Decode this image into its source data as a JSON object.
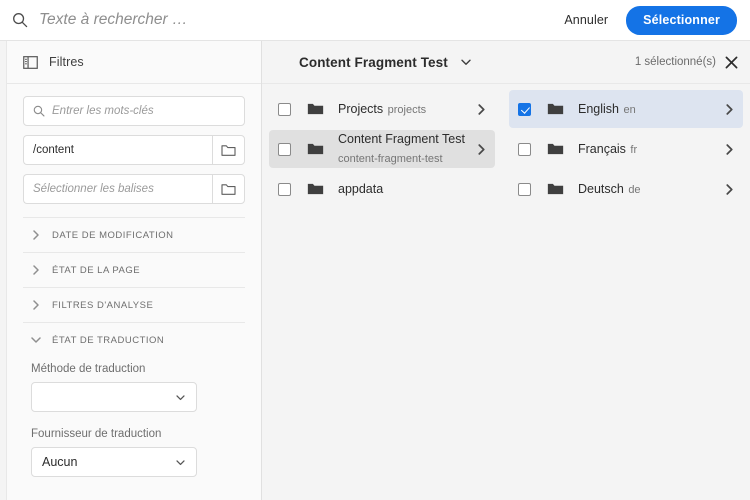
{
  "header": {
    "search_placeholder": "Texte à rechercher …",
    "search_value": "",
    "search_icon": "search-icon",
    "cancel_label": "Annuler",
    "select_label": "Sélectionner",
    "accent_color": "#1473e6"
  },
  "sidebar": {
    "panel_icon": "rail-left-icon",
    "title": "Filtres",
    "keyword_field": {
      "icon": "search-icon",
      "placeholder": "Entrer les mots-clés",
      "value": ""
    },
    "path_field": {
      "placeholder": "",
      "value": "/content",
      "picker_icon": "folder-open-icon"
    },
    "tags_field": {
      "placeholder": "Sélectionner les balises",
      "value": "",
      "picker_icon": "folder-open-icon"
    },
    "accordions": [
      {
        "label": "Date de modification",
        "expanded": false,
        "icon": "chevron-right-icon"
      },
      {
        "label": "État de la page",
        "expanded": false,
        "icon": "chevron-right-icon"
      },
      {
        "label": "Filtres d'analyse",
        "expanded": false,
        "icon": "chevron-right-icon"
      },
      {
        "label": "État de traduction",
        "expanded": true,
        "icon": "chevron-down-icon"
      }
    ],
    "translation_section": {
      "method_label": "Méthode de traduction",
      "method_value": "",
      "provider_label": "Fournisseur de traduction",
      "provider_value": "Aucun",
      "dropdown_icon": "chevron-down-icon"
    }
  },
  "browser": {
    "breadcrumb_title": "Content Fragment Test",
    "breadcrumb_icon": "chevron-down-icon",
    "selection_count_label": "1 sélectionné(s)",
    "close_icon": "close-icon",
    "columns": [
      {
        "name": "middle-column",
        "rows": [
          {
            "title": "Projects",
            "subtitle": "projects",
            "checked": false,
            "highlighted": false,
            "has_children": true,
            "icon": "folder-icon"
          },
          {
            "title": "Content Fragment Test",
            "subtitle": "content-fragment-test",
            "checked": false,
            "highlighted": true,
            "has_children": true,
            "icon": "folder-icon"
          },
          {
            "title": "appdata",
            "subtitle": "",
            "checked": false,
            "highlighted": false,
            "has_children": false,
            "icon": "folder-icon"
          }
        ]
      },
      {
        "name": "right-column",
        "rows": [
          {
            "title": "English",
            "subtitle": "en",
            "checked": true,
            "highlighted": false,
            "selected": true,
            "has_children": true,
            "icon": "folder-icon"
          },
          {
            "title": "Français",
            "subtitle": "fr",
            "checked": false,
            "highlighted": false,
            "selected": false,
            "has_children": true,
            "icon": "folder-icon"
          },
          {
            "title": "Deutsch",
            "subtitle": "de",
            "checked": false,
            "highlighted": false,
            "selected": false,
            "has_children": true,
            "icon": "folder-icon"
          }
        ]
      }
    ]
  }
}
